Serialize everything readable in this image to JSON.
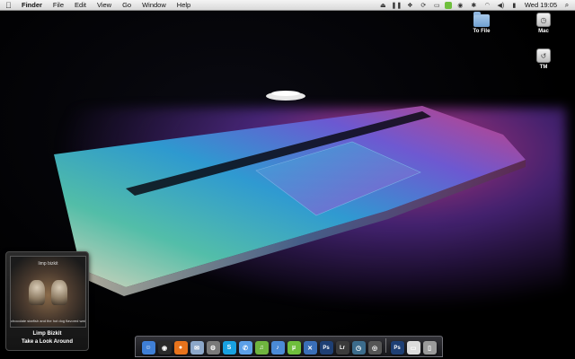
{
  "menubar": {
    "apple_icon": "apple-icon",
    "items": [
      "Finder",
      "File",
      "Edit",
      "View",
      "Go",
      "Window",
      "Help"
    ],
    "status_icons": [
      "eject-icon",
      "pause-icon",
      "dropbox-icon",
      "sync-icon",
      "monitor-icon",
      "skype-icon",
      "record-icon",
      "bluetooth-icon",
      "airport-icon",
      "volume-icon",
      "battery-icon"
    ],
    "clock": "Wed 19:05",
    "spotlight_icon": "spotlight-icon"
  },
  "desktop_icons": [
    {
      "label": "To File",
      "icon": "folder-icon"
    },
    {
      "label": "Mac",
      "icon": "hard-drive-icon"
    },
    {
      "label": "TM",
      "icon": "time-machine-disk-icon"
    }
  ],
  "now_playing": {
    "cover_band": "limp bizkit",
    "cover_album": "chocolate starfish and the hot dog flavored water",
    "artist": "Limp Bizkit",
    "track": "Take a Look Around"
  },
  "dock": {
    "apps": [
      {
        "name": "finder",
        "color": "#3f7fd6",
        "glyph": "☺"
      },
      {
        "name": "dashboard",
        "color": "#2a2a2a",
        "glyph": "◉"
      },
      {
        "name": "firefox",
        "color": "#e8731c",
        "glyph": "●"
      },
      {
        "name": "mail",
        "color": "#8ca7c9",
        "glyph": "✉"
      },
      {
        "name": "system-preferences",
        "color": "#7a7a7a",
        "glyph": "⚙"
      },
      {
        "name": "skype",
        "color": "#19a1e0",
        "glyph": "S"
      },
      {
        "name": "ichat",
        "color": "#5ca0e8",
        "glyph": "✆"
      },
      {
        "name": "spotify",
        "color": "#6fb43f",
        "glyph": "♫"
      },
      {
        "name": "itunes",
        "color": "#4b8bd6",
        "glyph": "♪"
      },
      {
        "name": "utorrent",
        "color": "#6fbf3c",
        "glyph": "µ"
      },
      {
        "name": "xcode",
        "color": "#3a6fb8",
        "glyph": "✕"
      },
      {
        "name": "photoshop",
        "color": "#1e3f74",
        "glyph": "Ps"
      },
      {
        "name": "lightroom",
        "color": "#3b3b3b",
        "glyph": "Lr"
      },
      {
        "name": "time-machine",
        "color": "#3c6c8c",
        "glyph": "◷"
      },
      {
        "name": "activity-monitor",
        "color": "#555",
        "glyph": "◎"
      }
    ],
    "stacks": [
      {
        "name": "photoshop-doc",
        "color": "#1e3f74",
        "glyph": "Ps"
      },
      {
        "name": "preview-stack",
        "color": "#dcdcdc",
        "glyph": "▭"
      },
      {
        "name": "trash",
        "color": "#9a9a9a",
        "glyph": "▯"
      }
    ]
  }
}
